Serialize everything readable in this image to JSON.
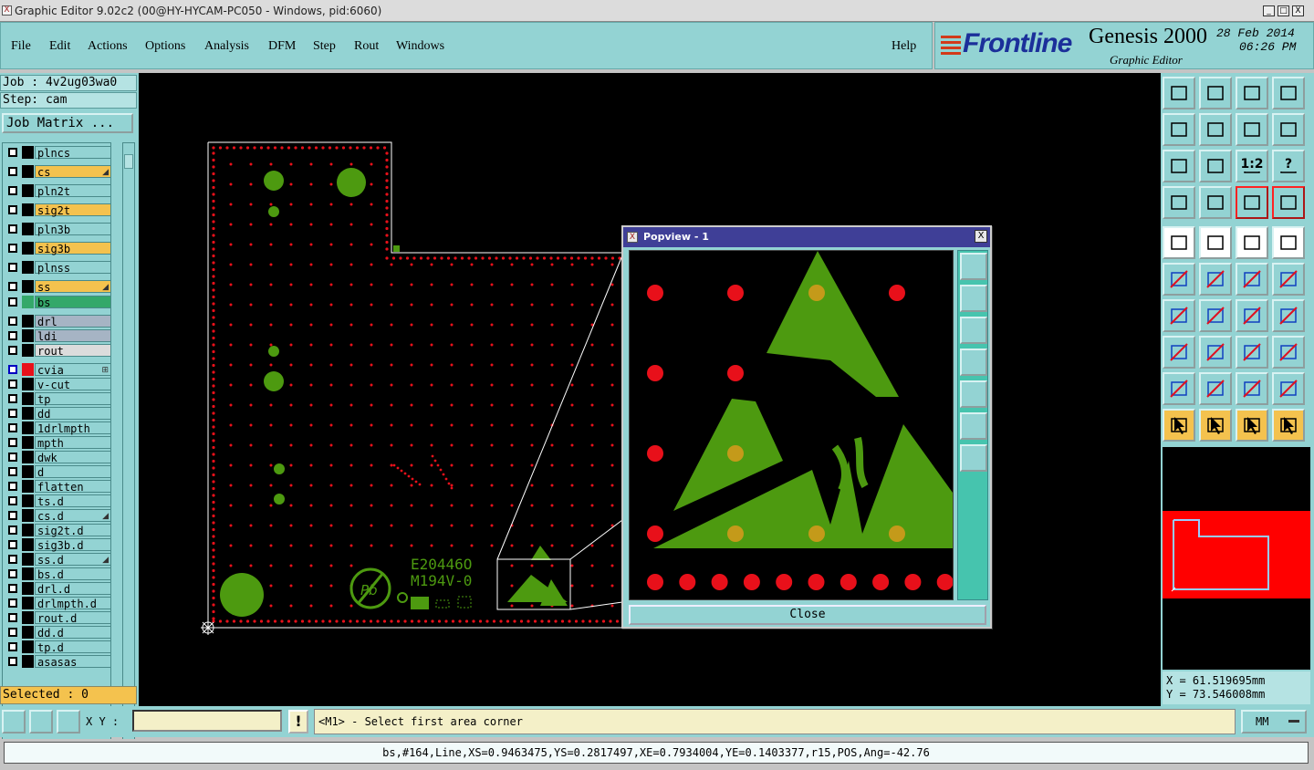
{
  "window": {
    "title": "Graphic Editor 9.02c2 (00@HY-HYCAM-PC050 - Windows, pid:6060)",
    "icon_glyph": "X",
    "minimize": "_",
    "maximize": "□",
    "close": "X"
  },
  "menu": [
    "File",
    "Edit",
    "Actions",
    "Options",
    "Analysis",
    "DFM",
    "Step",
    "Rout",
    "Windows"
  ],
  "help": "Help",
  "brand": {
    "logo": "Frontline",
    "product": "Genesis 2000",
    "subtitle": "Graphic Editor",
    "date": "28 Feb 2014",
    "time": "06:26 PM"
  },
  "job": {
    "job": "Job : 4v2ug03wa0",
    "step": "Step: cam",
    "matrix_button": "Job Matrix ..."
  },
  "layers": [
    {
      "name": "plncs",
      "color": "#93d3d3",
      "mark": ""
    },
    {
      "name": "cs",
      "color": "#f4c24e",
      "mark": "◢"
    },
    {
      "name": "pln2t",
      "color": "#93d3d3",
      "mark": ""
    },
    {
      "name": "sig2t",
      "color": "#f4c24e",
      "mark": ""
    },
    {
      "name": "pln3b",
      "color": "#93d3d3",
      "mark": ""
    },
    {
      "name": "sig3b",
      "color": "#f4c24e",
      "mark": ""
    },
    {
      "name": "plnss",
      "color": "#93d3d3",
      "mark": ""
    },
    {
      "name": "ss",
      "color": "#f4c24e",
      "mark": "◢"
    },
    {
      "name": "bs",
      "color": "#34a86a",
      "mark": ""
    },
    {
      "name": "drl",
      "color": "#a6b4c4",
      "mark": ""
    },
    {
      "name": "ldi",
      "color": "#a6b4c4",
      "mark": ""
    },
    {
      "name": "rout",
      "color": "#dcdcdc",
      "mark": ""
    },
    {
      "name": "cvia",
      "color": "#93d3d3",
      "mark": "⊞"
    },
    {
      "name": "v-cut",
      "color": "#93d3d3",
      "mark": ""
    },
    {
      "name": "tp",
      "color": "#93d3d3",
      "mark": ""
    },
    {
      "name": "dd",
      "color": "#93d3d3",
      "mark": ""
    },
    {
      "name": "1drlmpth",
      "color": "#93d3d3",
      "mark": ""
    },
    {
      "name": "mpth",
      "color": "#93d3d3",
      "mark": ""
    },
    {
      "name": "dwk",
      "color": "#93d3d3",
      "mark": ""
    },
    {
      "name": "d",
      "color": "#93d3d3",
      "mark": ""
    },
    {
      "name": "flatten",
      "color": "#93d3d3",
      "mark": ""
    },
    {
      "name": "ts.d",
      "color": "#93d3d3",
      "mark": ""
    },
    {
      "name": "cs.d",
      "color": "#93d3d3",
      "mark": "◢"
    },
    {
      "name": "sig2t.d",
      "color": "#93d3d3",
      "mark": ""
    },
    {
      "name": "sig3b.d",
      "color": "#93d3d3",
      "mark": ""
    },
    {
      "name": "ss.d",
      "color": "#93d3d3",
      "mark": "◢"
    },
    {
      "name": "bs.d",
      "color": "#93d3d3",
      "mark": ""
    },
    {
      "name": "drl.d",
      "color": "#93d3d3",
      "mark": ""
    },
    {
      "name": "drlmpth.d",
      "color": "#93d3d3",
      "mark": ""
    },
    {
      "name": "rout.d",
      "color": "#93d3d3",
      "mark": ""
    },
    {
      "name": "dd.d",
      "color": "#93d3d3",
      "mark": ""
    },
    {
      "name": "tp.d",
      "color": "#93d3d3",
      "mark": ""
    },
    {
      "name": "asasas",
      "color": "#93d3d3",
      "mark": ""
    }
  ],
  "selected": "Selected : 0",
  "board_text": {
    "line1": "E20446O",
    "line2": "M194V-0",
    "pb": "Pb"
  },
  "popview": {
    "title": "Popview - 1",
    "close_label": "Close"
  },
  "coords": {
    "x": "X = 61.519695mm",
    "y": "Y = 73.546008mm"
  },
  "toolbar_buttons": [
    "zoom-home",
    "zoom-back",
    "zoom-home-page",
    "zoom-grid",
    "pan-left",
    "pan-right",
    "zoom-prev",
    "zoom-redo",
    "zoom-fit",
    "zoom-center",
    "zoom-1-2",
    "query",
    "snap",
    "grid",
    "layer-shift",
    "layer-pair",
    "feature-draw",
    "feature-select",
    "ruler",
    "pad",
    "join",
    "cross",
    "move-point",
    "move-arc",
    "angle",
    "slope",
    "arc",
    "split",
    "copy",
    "cut",
    "mirror",
    "group",
    "mark-a",
    "mark-b",
    "mark-c",
    "mark-d",
    "pointer",
    "pointer-2",
    "pointer-3",
    "path"
  ],
  "toolbar_one_two": "1:2",
  "toolbar_question": "?",
  "bottom": {
    "xy_label": "X Y :",
    "xy_value": "",
    "excl": "!",
    "prompt": "<M1> - Select first area corner",
    "units": "MM"
  },
  "status": "bs,#164,Line,XS=0.9463475,YS=0.2817497,XE=0.7934004,YE=0.1403377,r15,POS,Ang=-42.76",
  "colors": {
    "pad": "#e8101a",
    "copper": "#4d9a10",
    "drill": "#c49a1a",
    "panel": "#93d3d3",
    "highlight": "#f4c24e"
  }
}
